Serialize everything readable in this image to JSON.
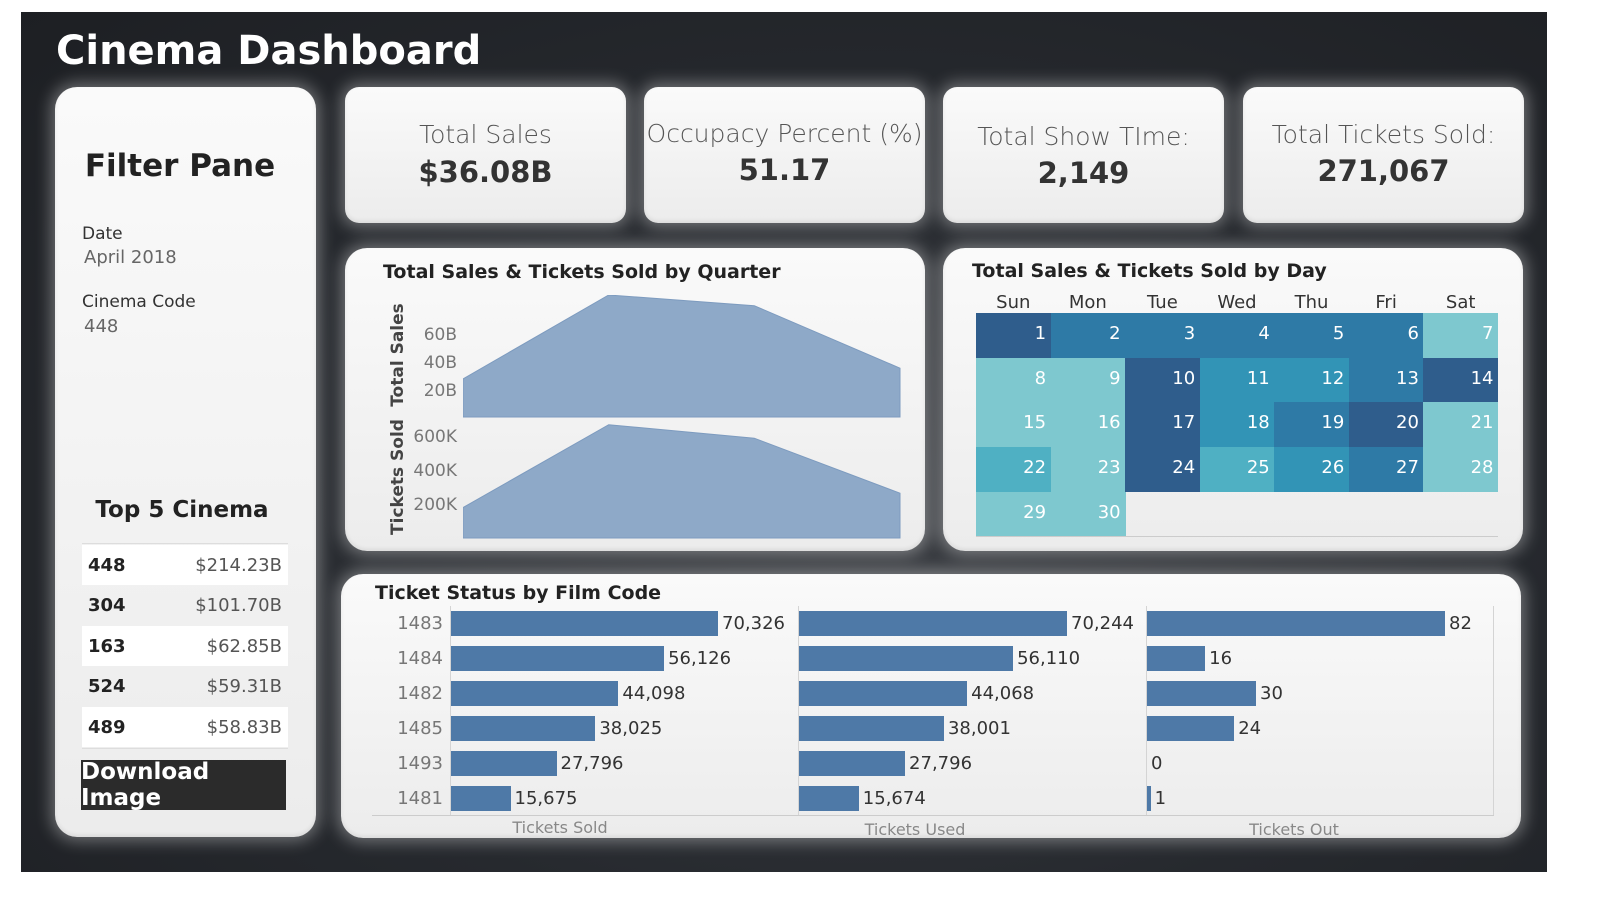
{
  "app_title": "Cinema Dashboard",
  "filter_pane": {
    "title": "Filter Pane",
    "date_label": "Date",
    "date_value": "April 2018",
    "cinema_label": "Cinema Code",
    "cinema_value": "448",
    "top5_title": "Top 5 Cinema",
    "top5": [
      {
        "code": "448",
        "amount": "$214.23B"
      },
      {
        "code": "304",
        "amount": "$101.70B"
      },
      {
        "code": "163",
        "amount": "$62.85B"
      },
      {
        "code": "524",
        "amount": "$59.31B"
      },
      {
        "code": "489",
        "amount": "$58.83B"
      }
    ],
    "download_label": "Download Image"
  },
  "kpis": [
    {
      "label": "Total Sales",
      "value": "$36.08B"
    },
    {
      "label": "Occupacy Percent (%)",
      "value": "51.17"
    },
    {
      "label": "Total Show TIme:",
      "value": "2,149"
    },
    {
      "label": "Total Tickets Sold:",
      "value": "271,067"
    }
  ],
  "colors": {
    "background": "#26292e",
    "card": "#f2f2f2",
    "bar": "#4e79a7",
    "area": "#8ea9c8",
    "calendar": [
      "#2f5d8c",
      "#2e7aa6",
      "#3294b6",
      "#4fb0c3",
      "#7ec8cf"
    ]
  },
  "chart_data": [
    {
      "type": "area",
      "title": "Total Sales & Tickets Sold by Quarter",
      "series": [
        {
          "name": "Total Sales",
          "ylabel": "Total Sales",
          "ticks": [
            "20B",
            "40B",
            "60B"
          ],
          "ylim": [
            0,
            80
          ],
          "values": [
            25,
            80,
            73,
            32
          ]
        },
        {
          "name": "Tickets Sold",
          "ylabel": "Tickets Sold",
          "ticks": [
            "200K",
            "400K",
            "600K"
          ],
          "ylim": [
            0,
            680
          ],
          "values": [
            180,
            670,
            590,
            265
          ]
        }
      ]
    },
    {
      "type": "heatmap",
      "title": "Total Sales & Tickets Sold by Day",
      "weekdays": [
        "Sun",
        "Mon",
        "Tue",
        "Wed",
        "Thu",
        "Fri",
        "Sat"
      ],
      "days": [
        {
          "day": "1",
          "level": 0
        },
        {
          "day": "2",
          "level": 1
        },
        {
          "day": "3",
          "level": 1
        },
        {
          "day": "4",
          "level": 1
        },
        {
          "day": "5",
          "level": 1
        },
        {
          "day": "6",
          "level": 1
        },
        {
          "day": "7",
          "level": 4
        },
        {
          "day": "8",
          "level": 4
        },
        {
          "day": "9",
          "level": 4
        },
        {
          "day": "10",
          "level": 0
        },
        {
          "day": "11",
          "level": 2
        },
        {
          "day": "12",
          "level": 2
        },
        {
          "day": "13",
          "level": 1
        },
        {
          "day": "14",
          "level": 0
        },
        {
          "day": "15",
          "level": 4
        },
        {
          "day": "16",
          "level": 4
        },
        {
          "day": "17",
          "level": 0
        },
        {
          "day": "18",
          "level": 2
        },
        {
          "day": "19",
          "level": 1
        },
        {
          "day": "20",
          "level": 0
        },
        {
          "day": "21",
          "level": 4
        },
        {
          "day": "22",
          "level": 3
        },
        {
          "day": "23",
          "level": 4
        },
        {
          "day": "24",
          "level": 0
        },
        {
          "day": "25",
          "level": 3
        },
        {
          "day": "26",
          "level": 2
        },
        {
          "day": "27",
          "level": 1
        },
        {
          "day": "28",
          "level": 4
        },
        {
          "day": "29",
          "level": 4
        },
        {
          "day": "30",
          "level": 4
        }
      ]
    },
    {
      "type": "bar",
      "title": "Ticket Status by Film Code",
      "categories": [
        "1483",
        "1484",
        "1482",
        "1485",
        "1493",
        "1481"
      ],
      "series": [
        {
          "name": "Tickets Sold",
          "values": [
            70326,
            56126,
            44098,
            38025,
            27796,
            15675
          ],
          "labels": [
            "70,326",
            "56,126",
            "44,098",
            "38,025",
            "27,796",
            "15,675"
          ],
          "max": 70326
        },
        {
          "name": "Tickets Used",
          "values": [
            70244,
            56110,
            44068,
            38001,
            27796,
            15674
          ],
          "labels": [
            "70,244",
            "56,110",
            "44,068",
            "38,001",
            "27,796",
            "15,674"
          ],
          "max": 70244
        },
        {
          "name": "Tickets Out",
          "values": [
            82,
            16,
            30,
            24,
            0,
            1
          ],
          "labels": [
            "82",
            "16",
            "30",
            "24",
            "0",
            "1"
          ],
          "max": 82
        }
      ]
    }
  ]
}
